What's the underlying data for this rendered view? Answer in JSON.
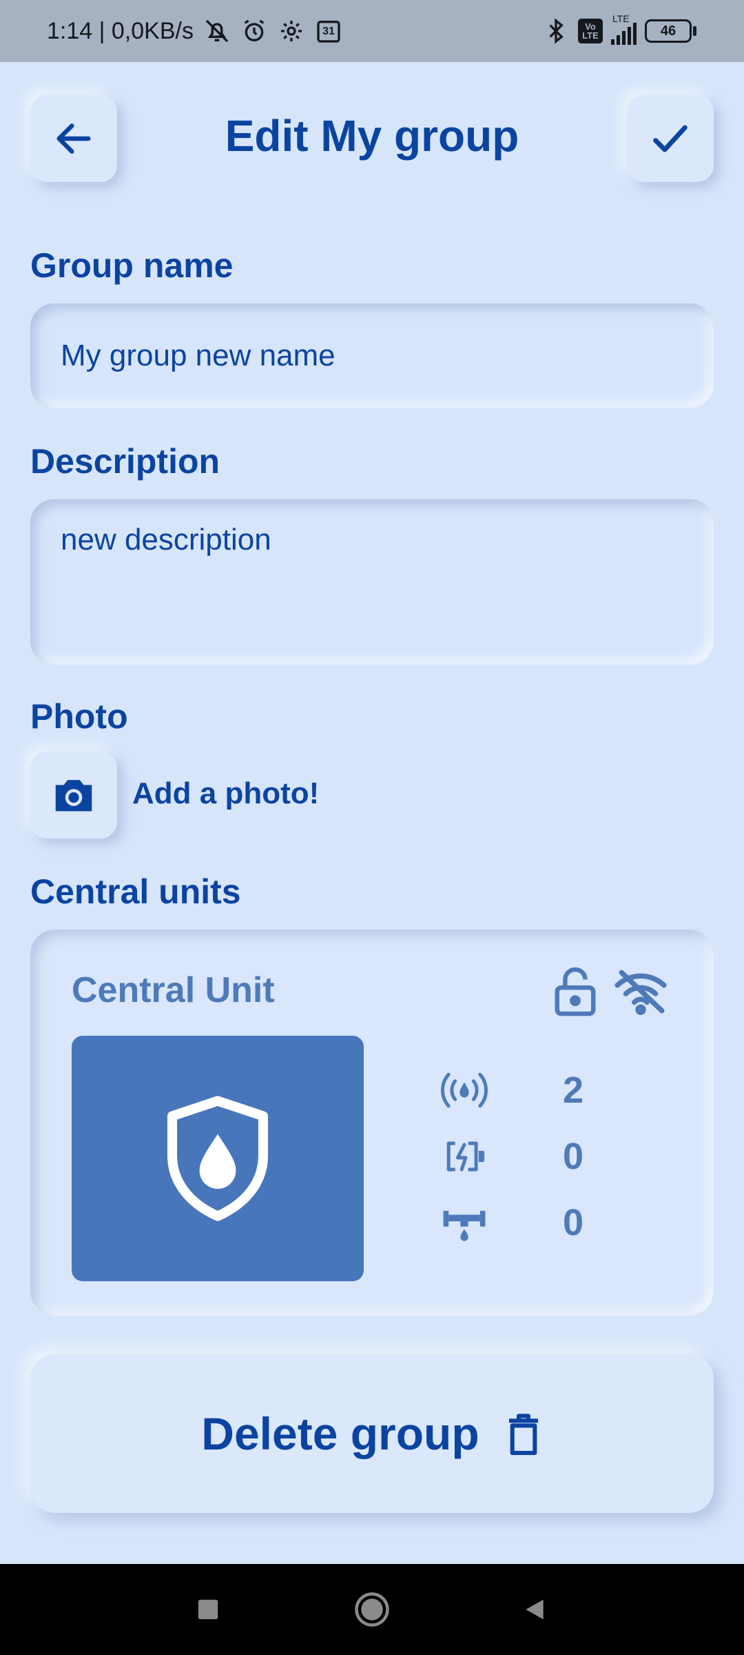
{
  "status_bar": {
    "time_and_speed": "1:14 | 0,0KB/s",
    "calendar_day": "31",
    "volte": "Vo LTE",
    "lte": "LTE",
    "battery": "46"
  },
  "header": {
    "title": "Edit My group",
    "back_icon": "arrow-left-icon",
    "confirm_icon": "checkmark-icon"
  },
  "form": {
    "group_name_label": "Group name",
    "group_name_value": "My group new name",
    "description_label": "Description",
    "description_value": "new description",
    "photo_label": "Photo",
    "add_photo_text": "Add a photo!"
  },
  "central_units": {
    "section_label": "Central units",
    "card": {
      "name": "Central Unit",
      "lock_icon": "unlocked-padlock-icon",
      "wifi_icon": "wifi-off-icon",
      "image_icon": "shield-water-drop-icon",
      "stats": [
        {
          "icon": "sensor-signal-icon",
          "value": "2"
        },
        {
          "icon": "battery-charge-icon",
          "value": "0"
        },
        {
          "icon": "water-valve-icon",
          "value": "0"
        }
      ]
    }
  },
  "actions": {
    "delete_label": "Delete group",
    "delete_icon": "trash-icon"
  },
  "colors": {
    "background": "#d7e5fb",
    "primary": "#0b44a0",
    "secondary": "#4d7ab9",
    "card_image": "#4876bb"
  }
}
